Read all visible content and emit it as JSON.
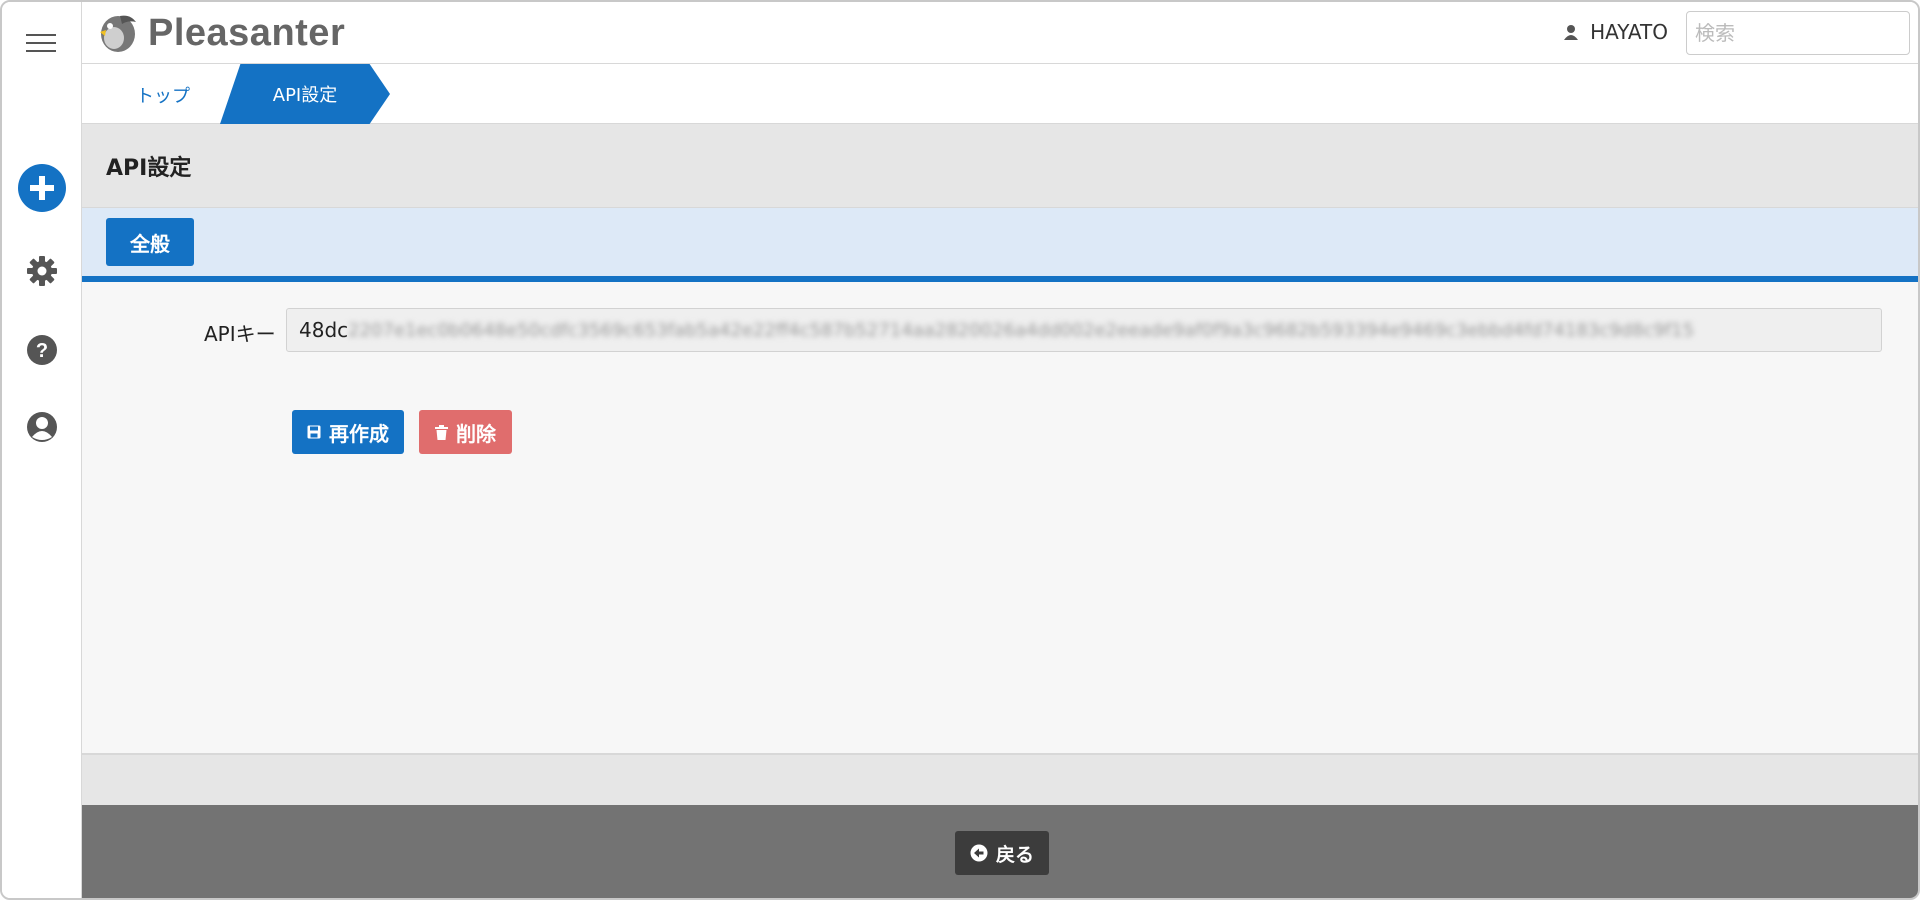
{
  "header": {
    "logo_text": "Pleasanter",
    "user_name": "HAYATO",
    "search_placeholder": "検索"
  },
  "breadcrumb": {
    "items": [
      "トップ",
      "API設定"
    ]
  },
  "page": {
    "title": "API設定"
  },
  "tabs": [
    {
      "label": "全般",
      "active": true
    }
  ],
  "form": {
    "api_key_label": "APIキー",
    "api_key_visible": "48dc",
    "api_key_blurred": "2207e1ec0b0648e50cdfc3569c653fab5a42e22ff4c587b52714aa2820026a4dd002e2eeade9af0f9a3c9682b593394e9469c3ebbd4fd74183c9d8c9f15"
  },
  "actions": {
    "recreate_label": "再作成",
    "delete_label": "削除"
  },
  "footer": {
    "back_label": "戻る"
  },
  "colors": {
    "primary": "#1472c4",
    "danger": "#e06d6d",
    "footer_bg": "#737373",
    "tab_bar_bg": "#dde9f7"
  },
  "icons": {
    "sidebar": [
      "menu-icon",
      "plus-icon",
      "gear-icon",
      "help-icon",
      "user-circle-icon"
    ],
    "user": "user-icon",
    "recreate": "save-icon",
    "delete": "trash-icon",
    "back": "back-arrow-icon"
  }
}
